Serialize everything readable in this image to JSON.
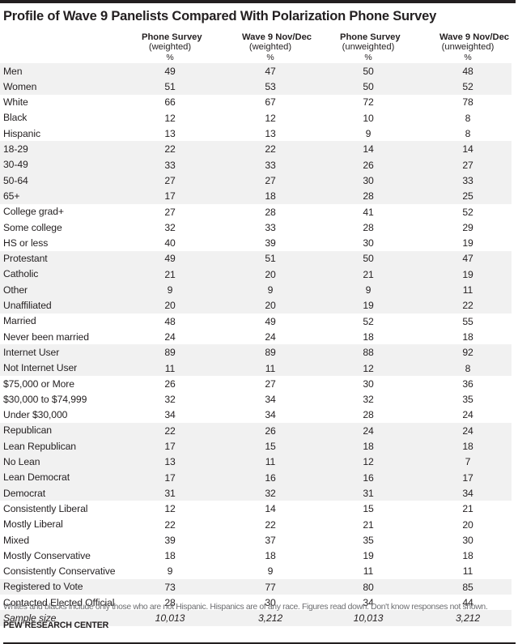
{
  "title": "Profile of Wave 9 Panelists Compared With Polarization Phone Survey",
  "columns": [
    {
      "line1": "Phone Survey",
      "line2": "(weighted)",
      "line3": "%"
    },
    {
      "line1": "Wave 9 Nov/Dec",
      "line2": "(weighted)",
      "line3": "%"
    },
    {
      "line1": "Phone Survey",
      "line2": "(unweighted)",
      "line3": "%"
    },
    {
      "line1": "Wave 9 Nov/Dec",
      "line2": "(unweighted)",
      "line3": "%"
    }
  ],
  "rows": [
    {
      "label": "Men",
      "values": [
        "49",
        "47",
        "50",
        "48"
      ],
      "shaded": true
    },
    {
      "label": "Women",
      "values": [
        "51",
        "53",
        "50",
        "52"
      ],
      "shaded": true
    },
    {
      "label": "White",
      "values": [
        "66",
        "67",
        "72",
        "78"
      ],
      "shaded": false
    },
    {
      "label": "Black",
      "values": [
        "12",
        "12",
        "10",
        "8"
      ],
      "shaded": false
    },
    {
      "label": "Hispanic",
      "values": [
        "13",
        "13",
        "9",
        "8"
      ],
      "shaded": false
    },
    {
      "label": "18-29",
      "values": [
        "22",
        "22",
        "14",
        "14"
      ],
      "shaded": true
    },
    {
      "label": "30-49",
      "values": [
        "33",
        "33",
        "26",
        "27"
      ],
      "shaded": true
    },
    {
      "label": "50-64",
      "values": [
        "27",
        "27",
        "30",
        "33"
      ],
      "shaded": true
    },
    {
      "label": "65+",
      "values": [
        "17",
        "18",
        "28",
        "25"
      ],
      "shaded": true
    },
    {
      "label": "College grad+",
      "values": [
        "27",
        "28",
        "41",
        "52"
      ],
      "shaded": false
    },
    {
      "label": "Some college",
      "values": [
        "32",
        "33",
        "28",
        "29"
      ],
      "shaded": false
    },
    {
      "label": "HS or less",
      "values": [
        "40",
        "39",
        "30",
        "19"
      ],
      "shaded": false
    },
    {
      "label": "Protestant",
      "values": [
        "49",
        "51",
        "50",
        "47"
      ],
      "shaded": true
    },
    {
      "label": "Catholic",
      "values": [
        "21",
        "20",
        "21",
        "19"
      ],
      "shaded": true
    },
    {
      "label": "Other",
      "values": [
        "9",
        "9",
        "9",
        "11"
      ],
      "shaded": true
    },
    {
      "label": "Unaffiliated",
      "values": [
        "20",
        "20",
        "19",
        "22"
      ],
      "shaded": true
    },
    {
      "label": "Married",
      "values": [
        "48",
        "49",
        "52",
        "55"
      ],
      "shaded": false
    },
    {
      "label": "Never been married",
      "values": [
        "24",
        "24",
        "18",
        "18"
      ],
      "shaded": false
    },
    {
      "label": "Internet User",
      "values": [
        "89",
        "89",
        "88",
        "92"
      ],
      "shaded": true
    },
    {
      "label": "Not Internet User",
      "values": [
        "11",
        "11",
        "12",
        "8"
      ],
      "shaded": true
    },
    {
      "label": "$75,000 or More",
      "values": [
        "26",
        "27",
        "30",
        "36"
      ],
      "shaded": false
    },
    {
      "label": "$30,000 to $74,999",
      "values": [
        "32",
        "34",
        "32",
        "35"
      ],
      "shaded": false
    },
    {
      "label": "Under $30,000",
      "values": [
        "34",
        "34",
        "28",
        "24"
      ],
      "shaded": false
    },
    {
      "label": "Republican",
      "values": [
        "22",
        "26",
        "24",
        "24"
      ],
      "shaded": true
    },
    {
      "label": "Lean Republican",
      "values": [
        "17",
        "15",
        "18",
        "18"
      ],
      "shaded": true
    },
    {
      "label": "No Lean",
      "values": [
        "13",
        "11",
        "12",
        "7"
      ],
      "shaded": true
    },
    {
      "label": "Lean Democrat",
      "values": [
        "17",
        "16",
        "16",
        "17"
      ],
      "shaded": true
    },
    {
      "label": "Democrat",
      "values": [
        "31",
        "32",
        "31",
        "34"
      ],
      "shaded": true
    },
    {
      "label": "Consistently Liberal",
      "values": [
        "12",
        "14",
        "15",
        "21"
      ],
      "shaded": false
    },
    {
      "label": "Mostly Liberal",
      "values": [
        "22",
        "22",
        "21",
        "20"
      ],
      "shaded": false
    },
    {
      "label": "Mixed",
      "values": [
        "39",
        "37",
        "35",
        "30"
      ],
      "shaded": false
    },
    {
      "label": "Mostly Conservative",
      "values": [
        "18",
        "18",
        "19",
        "18"
      ],
      "shaded": false
    },
    {
      "label": "Consistently Conservative",
      "values": [
        "9",
        "9",
        "11",
        "11"
      ],
      "shaded": false
    },
    {
      "label": "Registered to Vote",
      "values": [
        "73",
        "77",
        "80",
        "85"
      ],
      "shaded": true
    },
    {
      "label": "Contacted Elected Official",
      "values": [
        "28",
        "30",
        "34",
        "44"
      ],
      "shaded": false
    },
    {
      "label": "Sample size",
      "values": [
        "10,013",
        "3,212",
        "10,013",
        "3,212"
      ],
      "shaded": true,
      "italic": true
    }
  ],
  "footnote": "Whites and blacks include only those who are not Hispanic. Hispanics are of any race. Figures read down. Don't know responses not shown.",
  "source": "PEW RESEARCH CENTER",
  "colors": {
    "text": "#231f20",
    "shading": "#f1f1f1",
    "footnote_text": "#6d6e71",
    "rule": "#231f20"
  }
}
